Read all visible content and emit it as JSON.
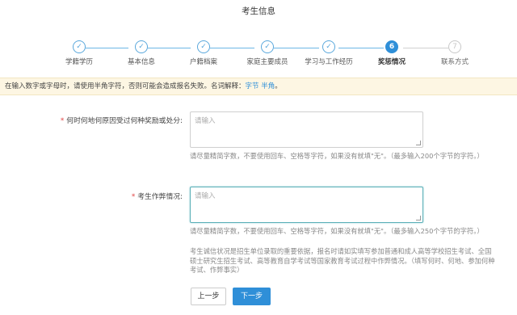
{
  "page_title": "考生信息",
  "steps": [
    {
      "label": "学籍学历",
      "status": "done",
      "mark": "✓"
    },
    {
      "label": "基本信息",
      "status": "done",
      "mark": "✓"
    },
    {
      "label": "户籍档案",
      "status": "done",
      "mark": "✓"
    },
    {
      "label": "家庭主要成员",
      "status": "done",
      "mark": "✓"
    },
    {
      "label": "学习与工作经历",
      "status": "done",
      "mark": "✓"
    },
    {
      "label": "奖惩情况",
      "status": "current",
      "mark": "6"
    },
    {
      "label": "联系方式",
      "status": "pending",
      "mark": "7"
    }
  ],
  "notice": {
    "text": "在输入数字或字母时，请使用半角字符，否则可能会造成报名失败。名词解释：",
    "kw1": "字节",
    "kw2": "半角",
    "end": "。"
  },
  "fields": {
    "rewards": {
      "required_mark": "*",
      "label": "何时何地何原因受过何种奖励或处分:",
      "placeholder": "请输入",
      "help": "请尽量精简字数，不要使用回车、空格等字符，如果没有就填\"无\"。（最多输入200个字节的字符。）"
    },
    "cheating": {
      "required_mark": "*",
      "label": "考生作弊情况:",
      "placeholder": "请输入",
      "help": "请尽量精简字数，不要使用回车、空格等字符，如果没有就填\"无\"。（最多输入250个字节的字符。）",
      "help2": "考生诚信状况是招生单位录取的重要依据，报名时请如实填写参加普通和成人高等学校招生考试、全国硕士研究生招生考试、高等教育自学考试等国家教育考试过程中作弊情况。（填写何时、何地、参加何种考试、作弊事实）"
    }
  },
  "buttons": {
    "prev": "上一步",
    "next": "下一步"
  },
  "colors": {
    "accent": "#2f8fd8",
    "notice_bg": "#fdf6e3",
    "required": "#e04040"
  }
}
